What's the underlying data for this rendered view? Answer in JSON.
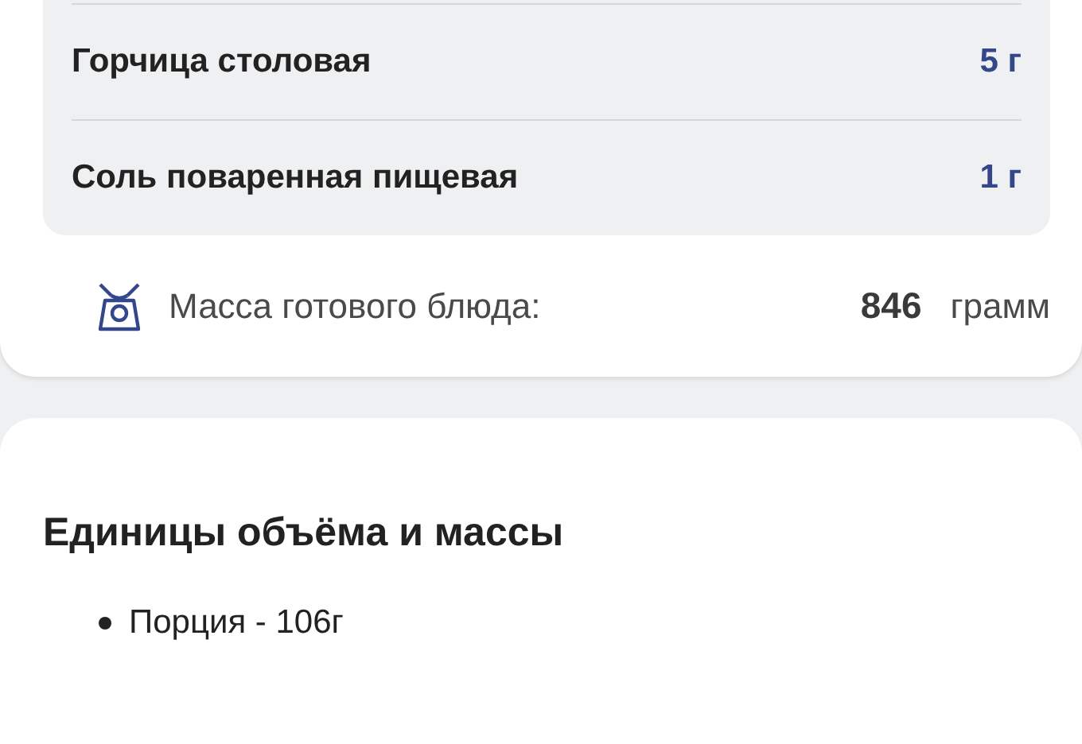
{
  "ingredients": [
    {
      "name": "Горчица столовая",
      "amount": "5 г"
    },
    {
      "name": "Соль поваренная пищевая",
      "amount": "1 г"
    }
  ],
  "total": {
    "label": "Масса готового блюда:",
    "value": "846",
    "unit": "грамм"
  },
  "units": {
    "title": "Единицы объёма и массы",
    "items": [
      "Порция - 106г"
    ]
  }
}
